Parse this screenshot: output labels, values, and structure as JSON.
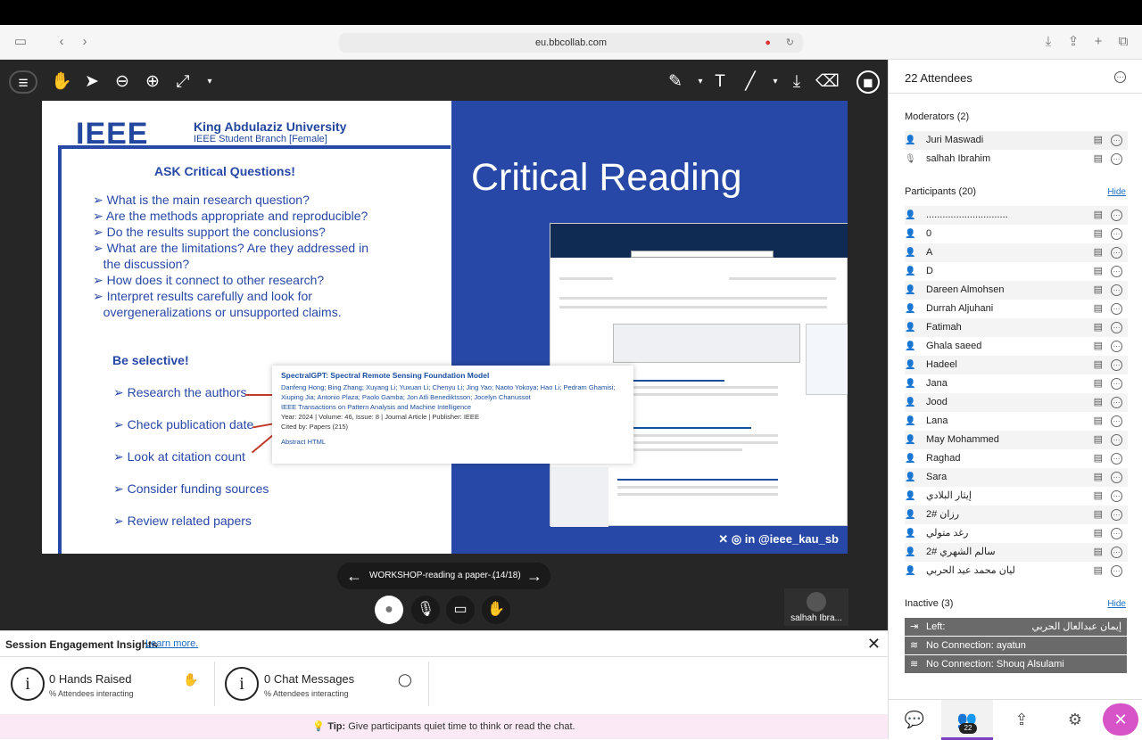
{
  "browser": {
    "url": "eu.bbcollab.com"
  },
  "slide": {
    "ieee_logo": "IEEE",
    "university": "King Abdulaziz University",
    "branch": "IEEE Student Branch [Female]",
    "heading": "ASK Critical Questions!",
    "questions": [
      "What is the main research question?",
      "Are the methods appropriate and reproducible?",
      "Do the results support the conclusions?",
      "What are the limitations? Are they addressed in",
      "the discussion?",
      "How does it connect to other research?",
      "Interpret results carefully and look for",
      "overgeneralizations or unsupported claims."
    ],
    "selective_heading": "Be selective!",
    "selective": [
      "Research the authors",
      "Check publication date",
      "Look at citation count",
      "Consider funding sources",
      "Review related papers"
    ],
    "title": "Critical Reading",
    "paper": {
      "title": "SpectralGPT: Spectral Remote Sensing Foundation Model",
      "authors": "Danfeng Hong; Bing Zhang; Xuyang Li; Yuxuan Li; Chenyu Li; Jing Yao; Naoto Yokoya; Hao Li; Pedram Ghamisi; Xiuping Jia; Antonio Plaza; Paolo Gamba; Jon Atli Benediktsson; Jocelyn Chanussot",
      "journal": "IEEE Transactions on Pattern Analysis and Machine Intelligence",
      "meta": "Year: 2024 | Volume: 46, Issue: 8 | Journal Article | Publisher: IEEE",
      "cited": "Cited by: Papers (215)",
      "links": "Abstract   HTML"
    },
    "social": "@ieee_kau_sb"
  },
  "slidenav": {
    "label": "WORKSHOP-reading a paper-...",
    "page": "(14/18)"
  },
  "speaker": {
    "name": "salhah Ibra..."
  },
  "insights": {
    "title": "Session Engagement Insights",
    "learn": "Learn more.",
    "hands": "0 Hands Raised",
    "hands_sub": "% Attendees interacting",
    "chat": "0 Chat Messages",
    "chat_sub": "% Attendees interacting"
  },
  "tip": {
    "label": "Tip:",
    "text": "Give participants quiet time to think or read the chat."
  },
  "panel": {
    "attendees": "22 Attendees",
    "moderators_header": "Moderators (2)",
    "moderators": [
      "Juri Maswadi",
      "salhah Ibrahim"
    ],
    "participants_header": "Participants (20)",
    "hide": "Hide",
    "participants": [
      "..............................",
      "0",
      "A",
      "D",
      "Dareen Almohsen",
      "Durrah Aljuhani",
      "Fatimah",
      "Ghala saeed",
      "Hadeel",
      "Jana",
      "Jood",
      "Lana",
      "May Mohammed",
      "Raghad",
      "Sara",
      "إيثار البلادي",
      "رزان #2",
      "رغد متولي",
      "سالم الشهري #2",
      "ليان محمد عيد الحربي"
    ],
    "inactive_header": "Inactive (3)",
    "inactive": [
      {
        "status": "Left:",
        "name": "إيمان عبدالعال الحربي"
      },
      {
        "status": "No Connection:",
        "name": "ayatun"
      },
      {
        "status": "No Connection:",
        "name": "Shouq Alsulami"
      }
    ],
    "tab_badge": "22"
  }
}
